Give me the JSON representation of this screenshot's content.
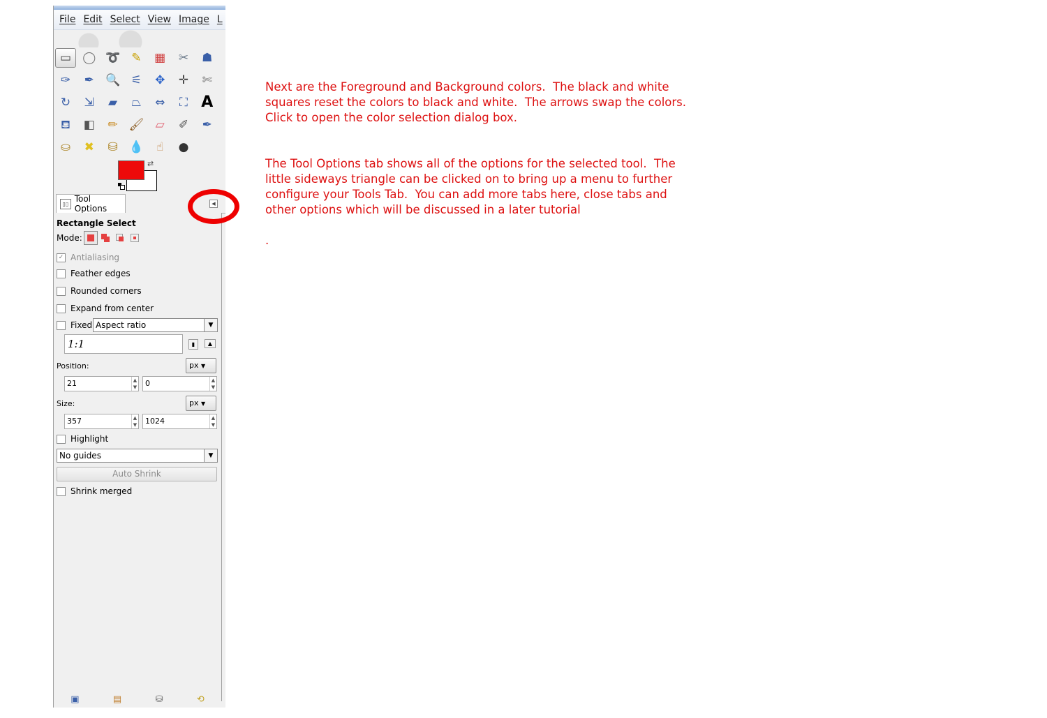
{
  "menubar": {
    "items": [
      "File",
      "Edit",
      "Select",
      "View",
      "Image",
      "L"
    ]
  },
  "tools": [
    {
      "name": "rect-select-icon",
      "glyph": "▭",
      "color": "#444444",
      "active": true
    },
    {
      "name": "ellipse-select-icon",
      "glyph": "◯",
      "color": "#777777"
    },
    {
      "name": "free-select-icon",
      "glyph": "➰",
      "color": "#777777"
    },
    {
      "name": "fuzzy-select-icon",
      "glyph": "✎",
      "color": "#c8a000"
    },
    {
      "name": "select-by-color-icon",
      "glyph": "▦",
      "color": "#d04040"
    },
    {
      "name": "scissors-select-icon",
      "glyph": "✂",
      "color": "#6b7a8a"
    },
    {
      "name": "foreground-select-icon",
      "glyph": "☗",
      "color": "#3a5fa8"
    },
    {
      "name": "paths-icon",
      "glyph": "✑",
      "color": "#3a5fa8"
    },
    {
      "name": "color-picker-icon",
      "glyph": "✒",
      "color": "#3a5fa8"
    },
    {
      "name": "zoom-icon",
      "glyph": "🔍",
      "color": "#3a5fa8"
    },
    {
      "name": "measure-icon",
      "glyph": "⚟",
      "color": "#3a5fa8"
    },
    {
      "name": "move-icon",
      "glyph": "✥",
      "color": "#2a62c9"
    },
    {
      "name": "align-icon",
      "glyph": "✛",
      "color": "#444444"
    },
    {
      "name": "crop-icon",
      "glyph": "✄",
      "color": "#777777"
    },
    {
      "name": "rotate-icon",
      "glyph": "↻",
      "color": "#3a5fa8"
    },
    {
      "name": "scale-icon",
      "glyph": "⇲",
      "color": "#3a5fa8"
    },
    {
      "name": "shear-icon",
      "glyph": "▰",
      "color": "#3a5fa8"
    },
    {
      "name": "perspective-icon",
      "glyph": "⏢",
      "color": "#3a5fa8"
    },
    {
      "name": "flip-icon",
      "glyph": "⇔",
      "color": "#3a5fa8"
    },
    {
      "name": "cage-transform-icon",
      "glyph": "⛶",
      "color": "#3a5fa8"
    },
    {
      "name": "text-icon",
      "glyph": "A",
      "color": "#000000"
    },
    {
      "name": "bucket-fill-icon",
      "glyph": "⛾",
      "color": "#3a5fa8"
    },
    {
      "name": "blend-icon",
      "glyph": "◧",
      "color": "#555555"
    },
    {
      "name": "pencil-icon",
      "glyph": "✏",
      "color": "#c88a20"
    },
    {
      "name": "paintbrush-icon",
      "glyph": "🖌",
      "color": "#8a5a20"
    },
    {
      "name": "eraser-icon",
      "glyph": "▱",
      "color": "#e06070"
    },
    {
      "name": "airbrush-icon",
      "glyph": "✐",
      "color": "#555555"
    },
    {
      "name": "ink-icon",
      "glyph": "✒",
      "color": "#3a5fa8"
    },
    {
      "name": "clone-icon",
      "glyph": "⛀",
      "color": "#b08a30"
    },
    {
      "name": "heal-icon",
      "glyph": "✖",
      "color": "#e0c020"
    },
    {
      "name": "perspective-clone-icon",
      "glyph": "⛁",
      "color": "#b08a30"
    },
    {
      "name": "blur-sharpen-icon",
      "glyph": "💧",
      "color": "#3a7fc8"
    },
    {
      "name": "smudge-icon",
      "glyph": "☝",
      "color": "#c08040"
    },
    {
      "name": "dodge-burn-icon",
      "glyph": "●",
      "color": "#333333"
    }
  ],
  "colors": {
    "foreground": "#ee0a0a",
    "background": "#ffffff",
    "annotation": "#ee0000",
    "note_text": "#dd1111"
  },
  "tab": {
    "label": "Tool Options"
  },
  "tool_options": {
    "title": "Rectangle Select",
    "mode_label": "Mode:",
    "antialiasing": {
      "label": "Antialiasing",
      "checked": true,
      "disabled": true
    },
    "feather_edges": {
      "label": "Feather edges",
      "checked": false
    },
    "rounded_corners": {
      "label": "Rounded corners",
      "checked": false
    },
    "expand_from_center": {
      "label": "Expand from center",
      "checked": false
    },
    "fixed": {
      "label": "Fixed:",
      "checked": false,
      "value": "Aspect ratio"
    },
    "ratio_value": "1:1",
    "position": {
      "label": "Position:",
      "unit": "px",
      "x": "21",
      "y": "0"
    },
    "size": {
      "label": "Size:",
      "unit": "px",
      "w": "357",
      "h": "1024"
    },
    "highlight": {
      "label": "Highlight",
      "checked": false
    },
    "guides": "No guides",
    "auto_shrink": "Auto Shrink",
    "shrink_merged": {
      "label": "Shrink merged",
      "checked": false
    }
  },
  "notes": {
    "para1": [
      "Next are the Foreground and Background colors.  The black and white",
      "squares reset the colors to black and white.  The arrows swap the colors.",
      "Click to open the color selection dialog box."
    ],
    "para2": [
      "The Tool Options tab shows all of the options for the selected tool.  The",
      "little sideways triangle can be clicked on to bring up a menu to further",
      "configure your Tools Tab.  You can add more tabs here, close tabs and",
      "other options which will be discussed in a later tutorial"
    ],
    "dot": "."
  }
}
